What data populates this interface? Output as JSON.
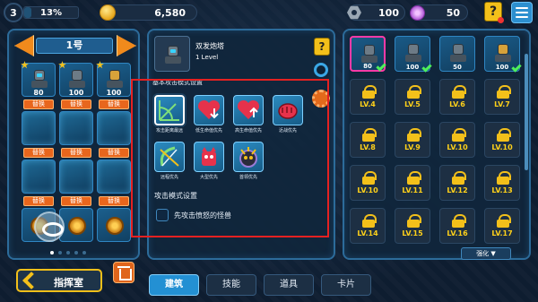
{
  "player": {
    "level": "3",
    "xp_percent": "13%",
    "xp_fraction": 0.13
  },
  "currencies": {
    "coins": "6,580",
    "bolts": "100",
    "gems": "50"
  },
  "top_icons": [
    "quest-icon",
    "menu-icon"
  ],
  "team_panel": {
    "title": "1号",
    "swap_label": "替换",
    "slots": [
      {
        "num": "80",
        "kind": "tower"
      },
      {
        "num": "100",
        "kind": "tower"
      },
      {
        "num": "100",
        "kind": "tower-gold"
      }
    ],
    "pager": {
      "total": 5,
      "current": 1
    }
  },
  "detail_panel": {
    "tower_name": "双发炮塔",
    "tower_level": "1 Level",
    "section_skill": "基本攻击模式设置",
    "skills": [
      {
        "name": "攻击距离最远",
        "icon": "range-icon"
      },
      {
        "name": "低生命值优先",
        "icon": "heart-down-icon"
      },
      {
        "name": "高生命值优先",
        "icon": "heart-up-icon"
      },
      {
        "name": "近战优先",
        "icon": "fist-icon"
      },
      {
        "name": "远程优先",
        "icon": "bow-icon"
      },
      {
        "name": "大型优先",
        "icon": "big-monster-icon"
      },
      {
        "name": "首领优先",
        "icon": "boss-icon"
      }
    ],
    "section_attack": "攻击模式设置",
    "checkbox_label": "先攻击愤怒的怪兽",
    "checkbox_checked": false
  },
  "tower_panel": {
    "owned": [
      {
        "num": "80",
        "active": true,
        "check": true
      },
      {
        "num": "100",
        "active": false,
        "check": true
      },
      {
        "num": "50",
        "active": false,
        "check": false
      },
      {
        "num": "100",
        "active": false,
        "check": true
      }
    ],
    "locked": [
      "LV.4",
      "LV.5",
      "LV.6",
      "LV.7",
      "LV.8",
      "LV.9",
      "LV.10",
      "LV.10",
      "LV.10",
      "LV.11",
      "LV.12",
      "LV.13",
      "LV.14",
      "LV.15",
      "LV.16",
      "LV.17"
    ],
    "enhance_label": "强化 ▼"
  },
  "bottom": {
    "back_label": "指挥室",
    "tabs": [
      {
        "label": "建筑",
        "active": true
      },
      {
        "label": "技能",
        "active": false
      },
      {
        "label": "道具",
        "active": false
      },
      {
        "label": "卡片",
        "active": false
      }
    ]
  },
  "colors": {
    "accent": "#2390d3",
    "highlight": "#e52121",
    "gold": "#f3c01a",
    "swap": "#e8661d"
  }
}
